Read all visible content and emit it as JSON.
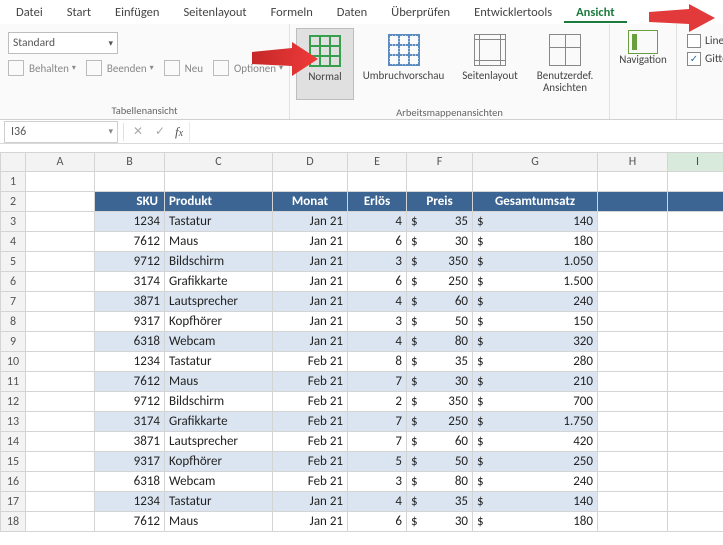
{
  "menu": {
    "tabs": [
      "Datei",
      "Start",
      "Einfügen",
      "Seitenlayout",
      "Formeln",
      "Daten",
      "Überprüfen",
      "Entwicklertools",
      "Ansicht"
    ],
    "active": "Ansicht"
  },
  "ribbon": {
    "group1": {
      "label": "Tabellenansicht",
      "combo": "Standard",
      "items": [
        "Behalten",
        "Beenden",
        "Neu",
        "Optionen"
      ]
    },
    "group2": {
      "label": "Arbeitsmappenansichten",
      "btn_normal": "Normal",
      "btn_break": "Umbruchvorschau",
      "btn_layout": "Seitenlayout",
      "btn_custom": "Benutzerdef. Ansichten"
    },
    "group3": {
      "btn_nav": "Navigation"
    },
    "group4": {
      "chk_lineal": "Line",
      "chk_gitter": "Gitte"
    }
  },
  "namebox": "I36",
  "columns": [
    "A",
    "B",
    "C",
    "D",
    "E",
    "F",
    "G",
    "H",
    "I"
  ],
  "table": {
    "headers": {
      "sku": "SKU",
      "produkt": "Produkt",
      "monat": "Monat",
      "erloes": "Erlös",
      "preis": "Preis",
      "gesamt": "Gesamtumsatz"
    },
    "currency": "$",
    "rows": [
      {
        "sku": "1234",
        "produkt": "Tastatur",
        "monat": "Jan 21",
        "erloes": "4",
        "preis": "35",
        "gesamt": "140"
      },
      {
        "sku": "7612",
        "produkt": "Maus",
        "monat": "Jan 21",
        "erloes": "6",
        "preis": "30",
        "gesamt": "180"
      },
      {
        "sku": "9712",
        "produkt": "Bildschirm",
        "monat": "Jan 21",
        "erloes": "3",
        "preis": "350",
        "gesamt": "1.050"
      },
      {
        "sku": "3174",
        "produkt": "Grafikkarte",
        "monat": "Jan 21",
        "erloes": "6",
        "preis": "250",
        "gesamt": "1.500"
      },
      {
        "sku": "3871",
        "produkt": "Lautsprecher",
        "monat": "Jan 21",
        "erloes": "4",
        "preis": "60",
        "gesamt": "240"
      },
      {
        "sku": "9317",
        "produkt": "Kopfhörer",
        "monat": "Jan 21",
        "erloes": "3",
        "preis": "50",
        "gesamt": "150"
      },
      {
        "sku": "6318",
        "produkt": "Webcam",
        "monat": "Jan 21",
        "erloes": "4",
        "preis": "80",
        "gesamt": "320"
      },
      {
        "sku": "1234",
        "produkt": "Tastatur",
        "monat": "Feb 21",
        "erloes": "8",
        "preis": "35",
        "gesamt": "280"
      },
      {
        "sku": "7612",
        "produkt": "Maus",
        "monat": "Feb 21",
        "erloes": "7",
        "preis": "30",
        "gesamt": "210"
      },
      {
        "sku": "9712",
        "produkt": "Bildschirm",
        "monat": "Feb 21",
        "erloes": "2",
        "preis": "350",
        "gesamt": "700"
      },
      {
        "sku": "3174",
        "produkt": "Grafikkarte",
        "monat": "Feb 21",
        "erloes": "7",
        "preis": "250",
        "gesamt": "1.750"
      },
      {
        "sku": "3871",
        "produkt": "Lautsprecher",
        "monat": "Feb 21",
        "erloes": "7",
        "preis": "60",
        "gesamt": "420"
      },
      {
        "sku": "9317",
        "produkt": "Kopfhörer",
        "monat": "Feb 21",
        "erloes": "5",
        "preis": "50",
        "gesamt": "250"
      },
      {
        "sku": "6318",
        "produkt": "Webcam",
        "monat": "Feb 21",
        "erloes": "3",
        "preis": "80",
        "gesamt": "240"
      },
      {
        "sku": "1234",
        "produkt": "Tastatur",
        "monat": "Jan 21",
        "erloes": "4",
        "preis": "35",
        "gesamt": "140"
      },
      {
        "sku": "7612",
        "produkt": "Maus",
        "monat": "Jan 21",
        "erloes": "6",
        "preis": "30",
        "gesamt": "180"
      }
    ]
  }
}
